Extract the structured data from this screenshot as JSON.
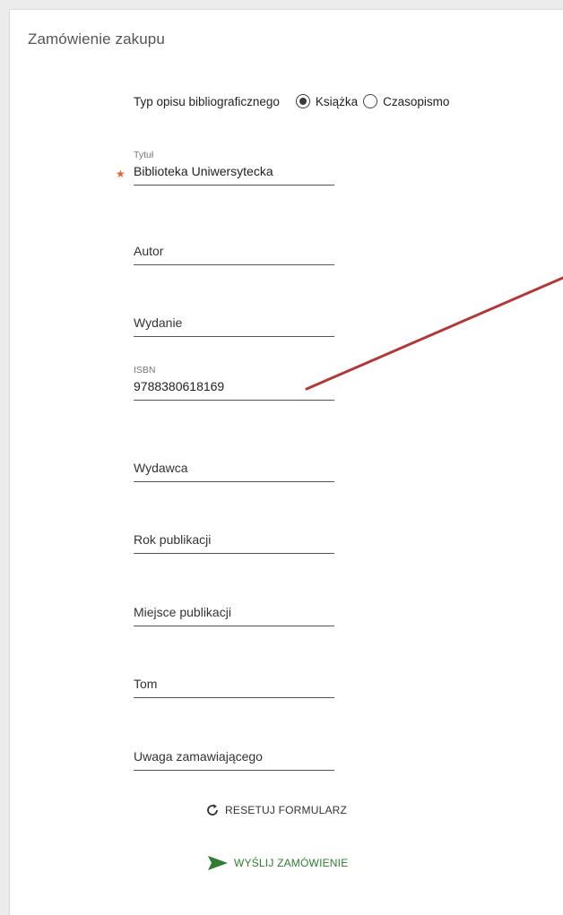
{
  "form": {
    "title": "Zamówienie zakupu",
    "type_label": "Typ opisu bibliograficznego",
    "type_options": [
      "Książka",
      "Czasopismo"
    ],
    "type_selected": "Książka",
    "fields": [
      {
        "label": "Tytuł",
        "value": "Biblioteka Uniwersytecka",
        "placeholder": "",
        "required": true
      },
      {
        "label": "",
        "value": "",
        "placeholder": "Autor",
        "required": false
      },
      {
        "label": "",
        "value": "",
        "placeholder": "Wydanie",
        "required": false
      },
      {
        "label": "ISBN",
        "value": "9788380618169",
        "placeholder": "",
        "required": false
      },
      {
        "label": "",
        "value": "",
        "placeholder": "Wydawca",
        "required": false
      },
      {
        "label": "",
        "value": "",
        "placeholder": "Rok publikacji",
        "required": false
      },
      {
        "label": "",
        "value": "",
        "placeholder": "Miejsce publikacji",
        "required": false
      },
      {
        "label": "",
        "value": "",
        "placeholder": "Tom",
        "required": false
      },
      {
        "label": "",
        "value": "",
        "placeholder": "Uwaga zamawiającego",
        "required": false
      }
    ],
    "reset_label": "RESETUJ FORMULARZ",
    "submit_label": "WYŚLIJ ZAMÓWIENIE"
  },
  "icons": {
    "reset": "refresh-icon",
    "submit": "send-arrow-icon",
    "required": "asterisk-icon"
  },
  "colors": {
    "required_star": "#e8603c",
    "submit": "#2e7d32",
    "annotation_line": "#b03a3a"
  }
}
